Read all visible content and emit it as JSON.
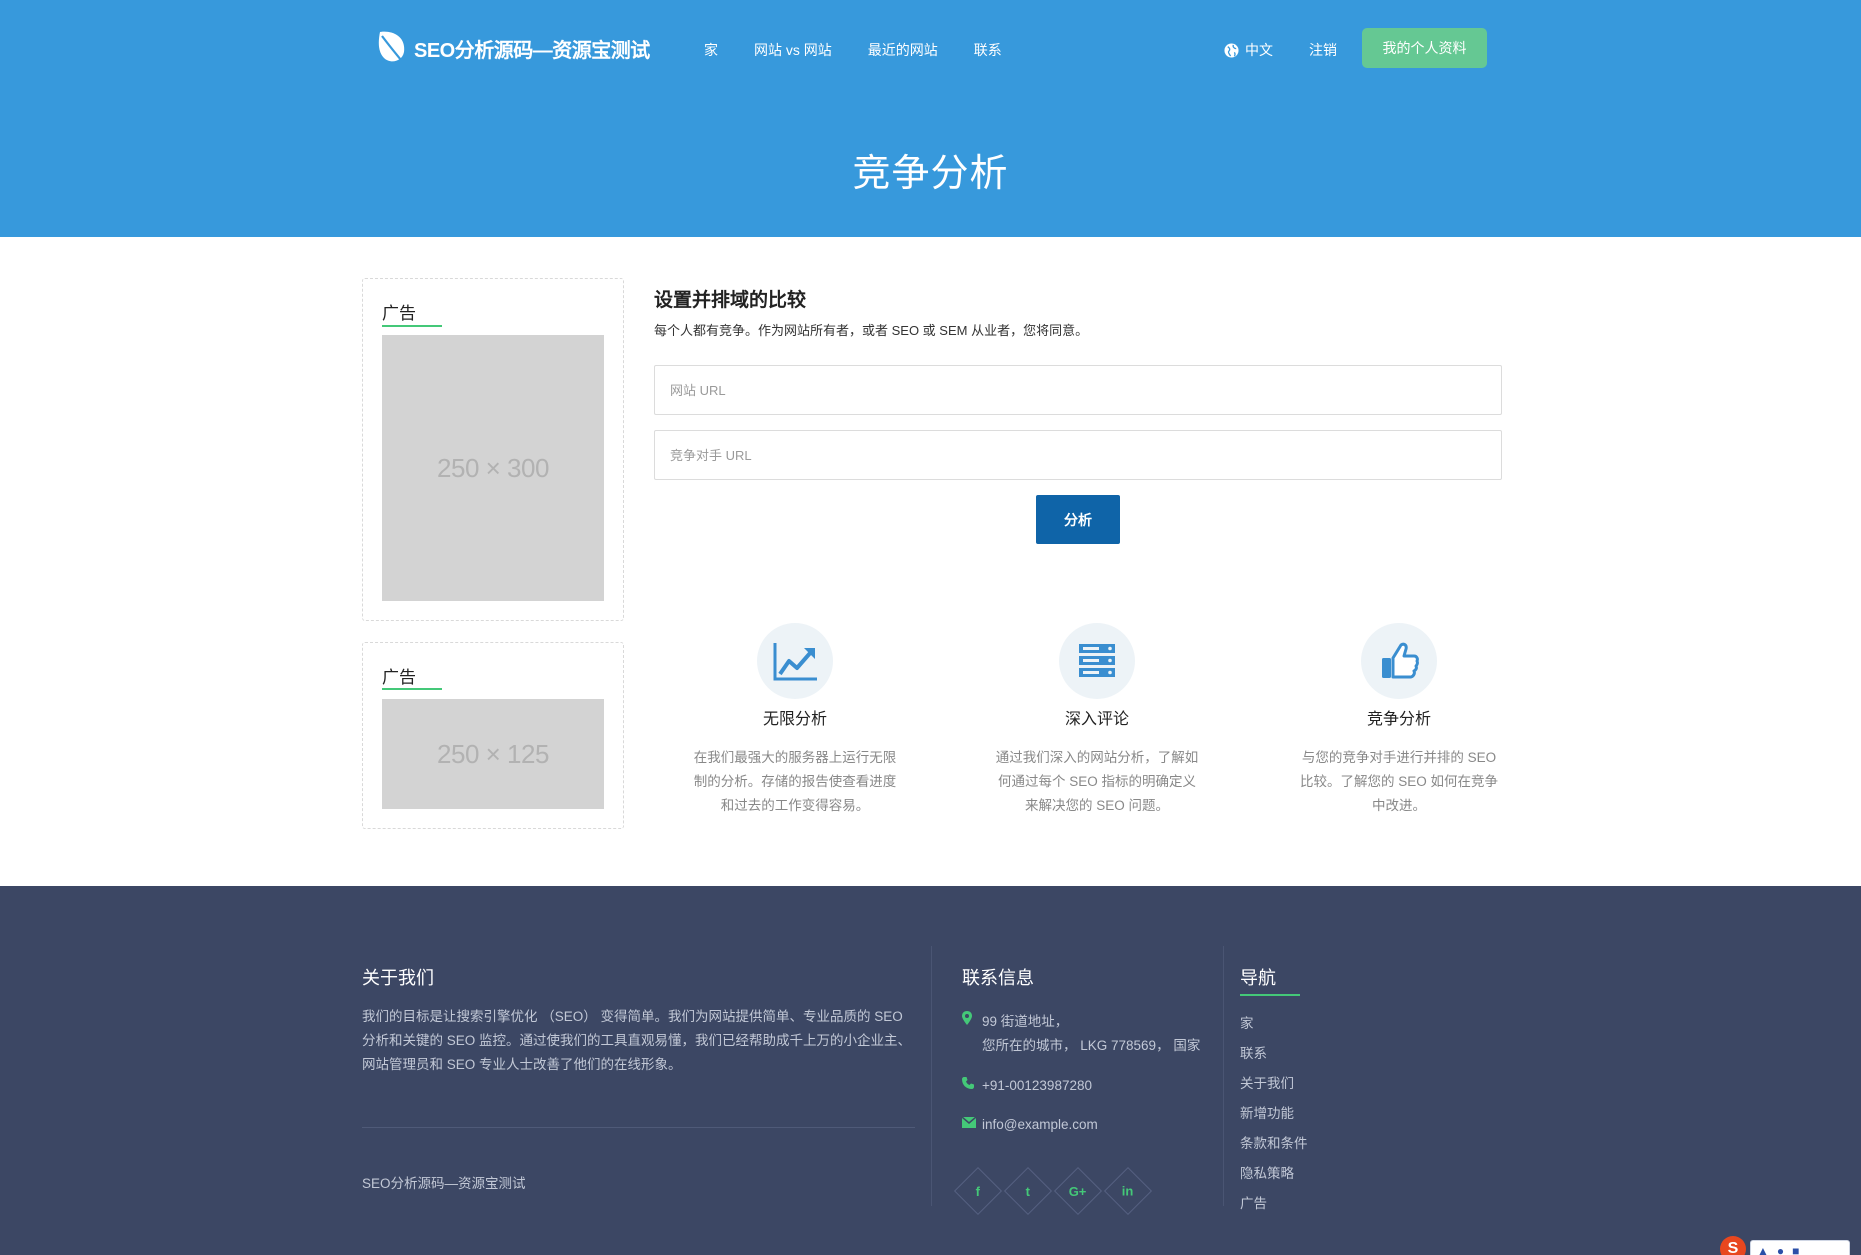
{
  "header": {
    "brand": "SEO分析源码—资源宝测试",
    "nav": [
      "家",
      "网站 vs 网站",
      "最近的网站",
      "联系"
    ],
    "language": "中文",
    "logout": "注销",
    "profile_button": "我的个人资料"
  },
  "page_title": "竞争分析",
  "ads": [
    {
      "title": "广告",
      "placeholder": "250 × 300"
    },
    {
      "title": "广告",
      "placeholder": "250 × 125"
    }
  ],
  "form": {
    "title": "设置并排域的比较",
    "description": "每个人都有竞争。作为网站所有者，或者 SEO 或 SEM 从业者，您将同意。",
    "site_url_placeholder": "网站 URL",
    "competitor_url_placeholder": "竞争对手 URL",
    "submit_label": "分析"
  },
  "features": [
    {
      "icon": "chart-line-icon",
      "title": "无限分析",
      "desc": "在我们最强大的服务器上运行无限制的分析。存储的报告使查看进度和过去的工作变得容易。"
    },
    {
      "icon": "server-icon",
      "title": "深入评论",
      "desc": "通过我们深入的网站分析，了解如何通过每个 SEO 指标的明确定义来解决您的 SEO 问题。"
    },
    {
      "icon": "thumbs-up-icon",
      "title": "竞争分析",
      "desc": "与您的竞争对手进行并排的 SEO 比较。了解您的 SEO 如何在竞争中改进。"
    }
  ],
  "footer": {
    "about_title": "关于我们",
    "about_text": "我们的目标是让搜索引擎优化 （SEO） 变得简单。我们为网站提供简单、专业品质的 SEO 分析和关键的 SEO 监控。通过使我们的工具直观易懂，我们已经帮助成千上万的小企业主、网站管理员和 SEO 专业人士改善了他们的在线形象。",
    "copyright": "SEO分析源码—资源宝测试",
    "contact_title": "联系信息",
    "address_line1": "99 街道地址，",
    "address_line2": "您所在的城市， LKG 778569， 国家",
    "phone": "+91-00123987280",
    "email": "info@example.com",
    "social": [
      "f",
      "t",
      "G+",
      "in"
    ],
    "nav_title": "导航",
    "nav_links": [
      "家",
      "联系",
      "关于我们",
      "新增功能",
      "条款和条件",
      "隐私策略",
      "广告"
    ]
  },
  "colors": {
    "header_blue": "#3799dc",
    "profile_green": "#65c893",
    "button_blue": "#0f64a8",
    "footer_navy": "#3c4764",
    "accent_green": "#44c878"
  }
}
